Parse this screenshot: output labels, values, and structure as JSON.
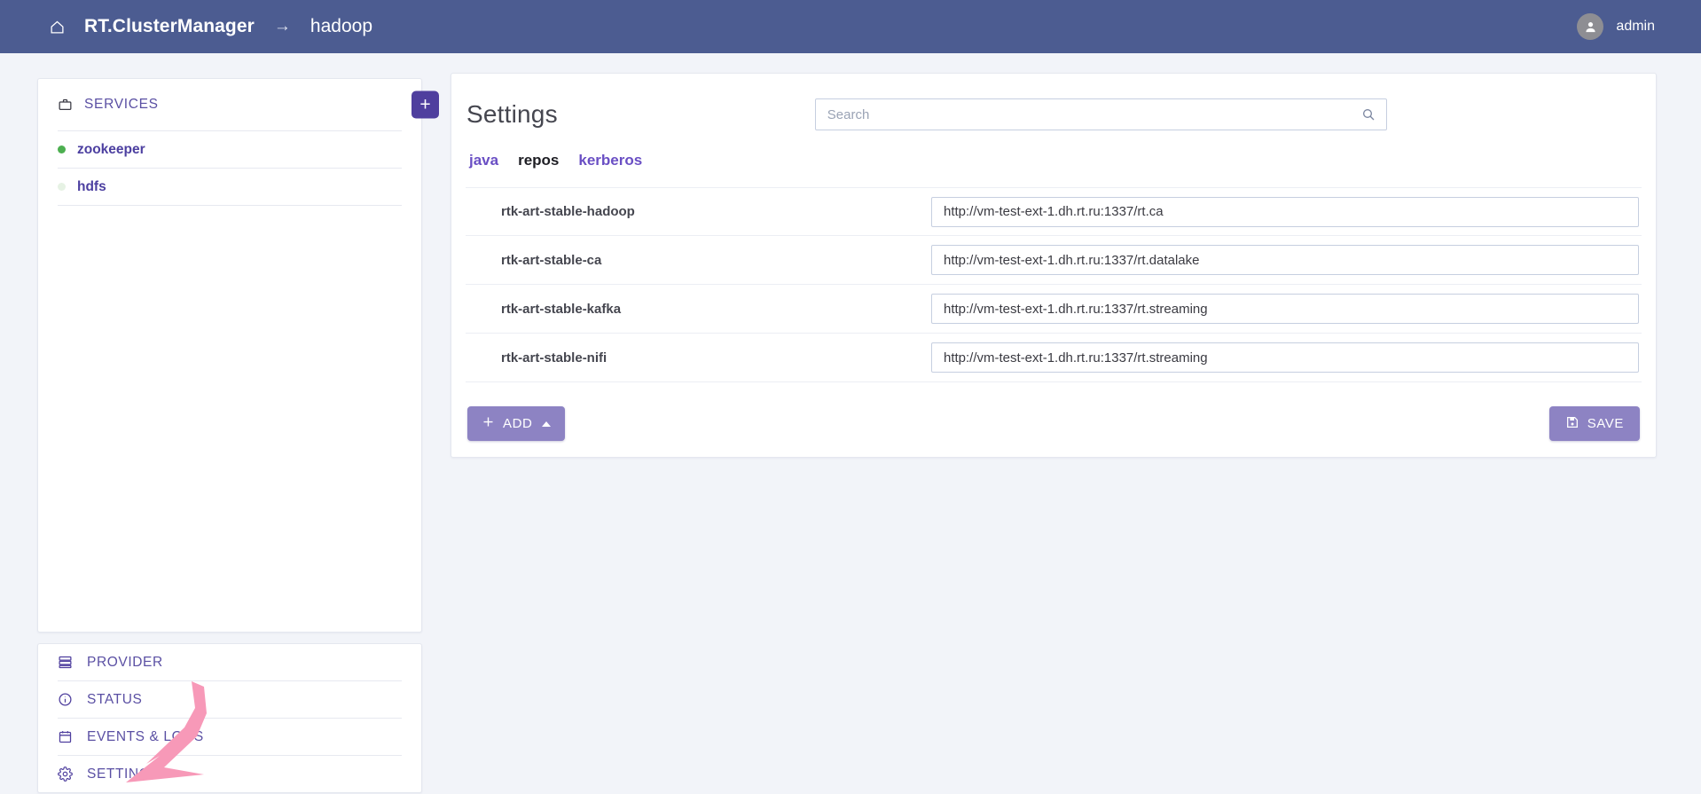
{
  "header": {
    "home_icon": "home-icon",
    "brand": "RT.ClusterManager",
    "separator": "→",
    "current": "hadoop",
    "user": "admin",
    "background_color": "#4c5c91"
  },
  "sidebar": {
    "services_title": "SERVICES",
    "services_icon": "briefcase-icon",
    "add_service_label": "+",
    "services": [
      {
        "name": "zookeeper",
        "status_color": "#4caf50",
        "status": "running"
      },
      {
        "name": "hdfs",
        "status_color": "#e8f4e6",
        "status": "stopped"
      }
    ],
    "menu": [
      {
        "label": "PROVIDER",
        "icon": "server-icon"
      },
      {
        "label": "STATUS",
        "icon": "info-circle-icon"
      },
      {
        "label": "EVENTS & LOGS",
        "icon": "calendar-icon"
      },
      {
        "label": "SETTINGS",
        "icon": "gear-icon"
      }
    ]
  },
  "main": {
    "title": "Settings",
    "search": {
      "placeholder": "Search",
      "value": ""
    },
    "tabs": [
      {
        "label": "java",
        "active": false
      },
      {
        "label": "repos",
        "active": true
      },
      {
        "label": "kerberos",
        "active": false
      }
    ],
    "rows": [
      {
        "label": "rtk-art-stable-hadoop",
        "value": "http://vm-test-ext-1.dh.rt.ru:1337/rt.ca"
      },
      {
        "label": "rtk-art-stable-ca",
        "value": "http://vm-test-ext-1.dh.rt.ru:1337/rt.datalake"
      },
      {
        "label": "rtk-art-stable-kafka",
        "value": "http://vm-test-ext-1.dh.rt.ru:1337/rt.streaming"
      },
      {
        "label": "rtk-art-stable-nifi",
        "value": "http://vm-test-ext-1.dh.rt.ru:1337/rt.streaming"
      }
    ],
    "add_button": "ADD",
    "save_button": "SAVE",
    "accent_color": "#8d83c3",
    "primary_color": "#4f3f9e"
  },
  "annotation": {
    "color": "#f799b8",
    "points_to": "SETTINGS"
  }
}
